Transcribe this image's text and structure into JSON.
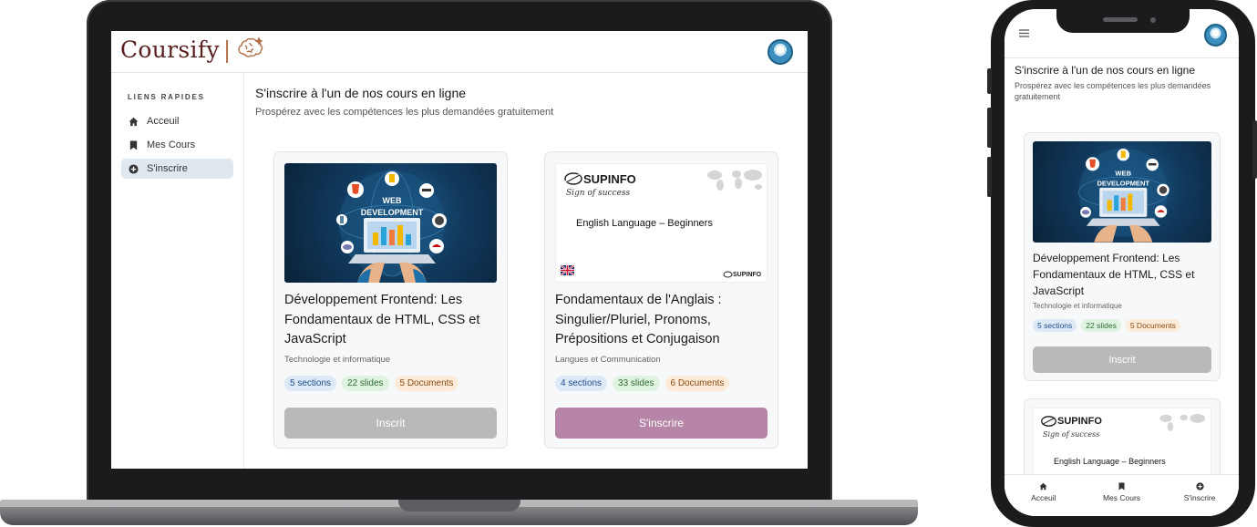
{
  "app": {
    "logo_text": "Coursify",
    "logo_separator": "|"
  },
  "sidebar": {
    "title": "LIENS RAPIDES",
    "items": [
      {
        "label": "Acceuil",
        "icon": "home-icon"
      },
      {
        "label": "Mes Cours",
        "icon": "bookmark-icon"
      },
      {
        "label": "S'inscrire",
        "icon": "plus-circle-icon",
        "active": true
      }
    ]
  },
  "main": {
    "title": "S'inscrire à l'un de nos cours en ligne",
    "subtitle": "Prospérez avec les compétences les plus demandées gratuitement"
  },
  "courses": [
    {
      "title": "Développement Frontend: Les Fondamentaux de HTML, CSS et JavaScript",
      "category": "Technologie et informatique",
      "sections": "5 sections",
      "slides": "22 slides",
      "documents": "5 Documents",
      "button": "Inscrit",
      "enrolled": true,
      "thumb_line1": "WEB",
      "thumb_line2": "DEVELOPMENT"
    },
    {
      "title": "Fondamentaux de l'Anglais : Singulier/Pluriel, Pronoms, Prépositions et Conjugaison",
      "category": "Langues et Communication",
      "sections": "4 sections",
      "slides": "33 slides",
      "documents": "6 Documents",
      "button": "S'inscrire",
      "enrolled": false,
      "thumb_brand": "SUPINFO",
      "thumb_tagline": "Sign of success",
      "thumb_course": "English Language – Beginners"
    }
  ],
  "mobile_nav": [
    {
      "label": "Acceuil",
      "icon": "home-icon"
    },
    {
      "label": "Mes Cours",
      "icon": "bookmark-icon"
    },
    {
      "label": "S'inscrire",
      "icon": "plus-circle-icon"
    }
  ],
  "colors": {
    "brand": "#5a1f1f",
    "primary_button": "#b584a6",
    "disabled_button": "#b9b9bb",
    "active_sidebar": "#dfe8ee"
  }
}
